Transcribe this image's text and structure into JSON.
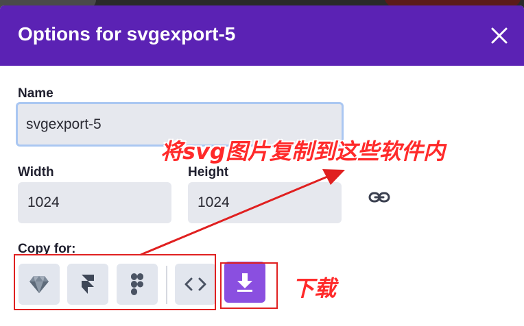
{
  "dialog": {
    "title": "Options for svgexport-5",
    "close_icon": "close-icon"
  },
  "name_field": {
    "label": "Name",
    "value": "svgexport-5"
  },
  "width_field": {
    "label": "Width",
    "value": "1024"
  },
  "height_field": {
    "label": "Height",
    "value": "1024"
  },
  "link_icon": "link-icon",
  "copy_for": {
    "label": "Copy for:",
    "buttons": [
      {
        "icon": "sketch-icon"
      },
      {
        "icon": "framer-icon"
      },
      {
        "icon": "figma-icon"
      },
      {
        "icon": "code-icon"
      }
    ],
    "download_icon": "download-icon"
  },
  "annotations": {
    "copy_note": "将svg图片复制到这些软件内",
    "download_note": "下载",
    "color": "#e02020"
  },
  "colors": {
    "header": "#5b22b4",
    "download_button": "#8a4fe0",
    "field_bg": "#e6e8ee"
  }
}
